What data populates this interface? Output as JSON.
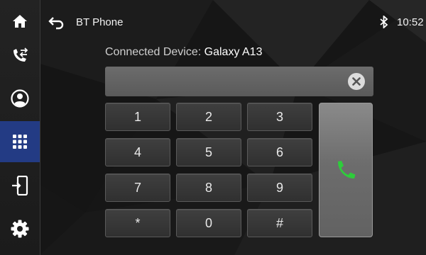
{
  "header": {
    "title": "BT Phone",
    "time": "10:52"
  },
  "sidebar": {
    "items": [
      {
        "icon": "home-icon"
      },
      {
        "icon": "call-log-icon"
      },
      {
        "icon": "contacts-icon"
      },
      {
        "icon": "dialpad-icon",
        "active": true
      },
      {
        "icon": "device-transfer-icon"
      },
      {
        "icon": "settings-icon"
      }
    ]
  },
  "device": {
    "label": "Connected Device:",
    "name": "Galaxy A13"
  },
  "dial": {
    "number": ""
  },
  "keypad": {
    "keys": [
      "1",
      "2",
      "3",
      "4",
      "5",
      "6",
      "7",
      "8",
      "9",
      "*",
      "0",
      "#"
    ]
  },
  "colors": {
    "accent": "#233b84",
    "call": "#2ecc3b"
  }
}
